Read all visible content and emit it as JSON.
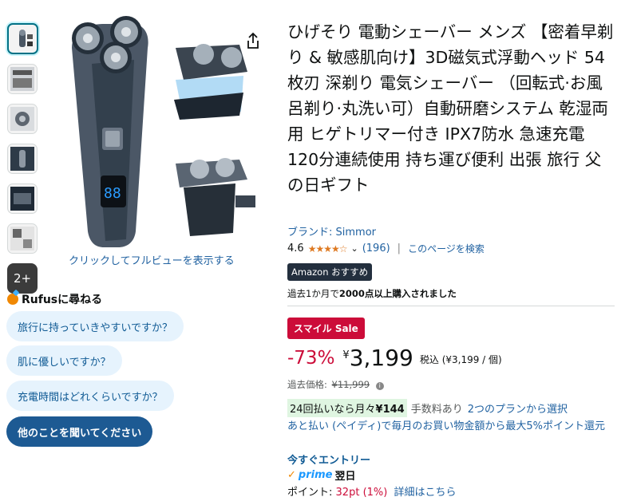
{
  "gallery": {
    "more_label": "2+",
    "fullview_label": "クリックしてフルビューを表示する"
  },
  "rufus": {
    "label": "Rufusに尋ねる",
    "questions": [
      "旅行に持っていきやすいですか？",
      "肌に優しいですか？",
      "充電時間はどれくらいですか？"
    ],
    "ask_more": "他のことを聞いてください"
  },
  "product": {
    "title": "ひげそり 電動シェーバー メンズ 【密着早剃り & 敏感肌向け】3D磁気式浮動ヘッド 54枚刃 深剃り 電気シェーバー （回転式·お風呂剃り·丸洗い可）自動研磨システム 乾湿両用 ヒゲトリマー付き IPX7防水 急速充電 120分連続使用 持ち運び便利 出張 旅行 父の日ギフト",
    "brand": "ブランド: Simmor",
    "rating": "4.6",
    "stars": "★★★★☆",
    "rating_value": 4.6,
    "review_count": "(196)",
    "search_page": "このページを検索",
    "badge": "Amazon おすすめ",
    "bought_prefix": "過去1か月で",
    "bought_bold": "2000点以上購入されました"
  },
  "pricing": {
    "deal_badge": "スマイル Sale",
    "discount": "-73%",
    "currency": "¥",
    "price": "3,199",
    "tax_note": "税込 (¥3,199 / 個)",
    "list_price_label": "過去価格:",
    "list_price": "¥11,999",
    "installment_prefix": "24回払いなら月々",
    "installment_amount": "¥144",
    "installment_fee": "手数料あり",
    "installment_plans": "2つのプランから選択",
    "paidy": "あと払い (ペイディ)で毎月のお買い物金額から最大5%ポイント還元",
    "entry": "今すぐエントリー"
  },
  "delivery": {
    "prime": "prime",
    "day": "翌日"
  },
  "points": {
    "label": "ポイント:",
    "amount": "32pt",
    "percent": "(1%)",
    "details": "詳細はこちら"
  },
  "colors": {
    "link": "#2162a1",
    "deal_red": "#cc0c39",
    "star": "#de7921"
  }
}
